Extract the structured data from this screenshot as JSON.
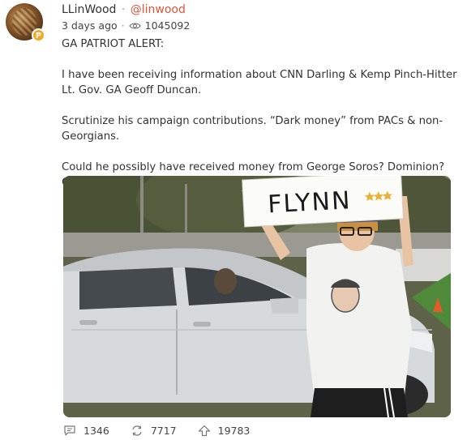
{
  "post": {
    "display_name": "LLinWood",
    "separator": "·",
    "handle": "@linwood",
    "time_ago": "3 days ago",
    "meta_separator": "·",
    "views": "1045092",
    "paragraphs": [
      "GA PATRIOT ALERT:",
      "I have been receiving information about CNN Darling & Kemp Pinch-Hitter Lt. Gov. GA Geoff Duncan.",
      "Scrutinize his campaign contributions. “Dark money” from PACs & non-Georgians.",
      "Could he possibly have received money from George Soros? Dominion? China? Gates?"
    ],
    "image": {
      "sign_text": "FLYNN"
    },
    "actions": {
      "comments": "1346",
      "reposts": "7717",
      "upvotes": "19783"
    }
  },
  "colors": {
    "handle": "#e0533b",
    "badge": "#f5a623",
    "text": "#333333",
    "meta": "#444444"
  },
  "icons": {
    "views": "eye-icon",
    "comments": "comment-icon",
    "reposts": "repost-icon",
    "upvotes": "upvote-icon",
    "badge": "verified-badge-icon"
  }
}
